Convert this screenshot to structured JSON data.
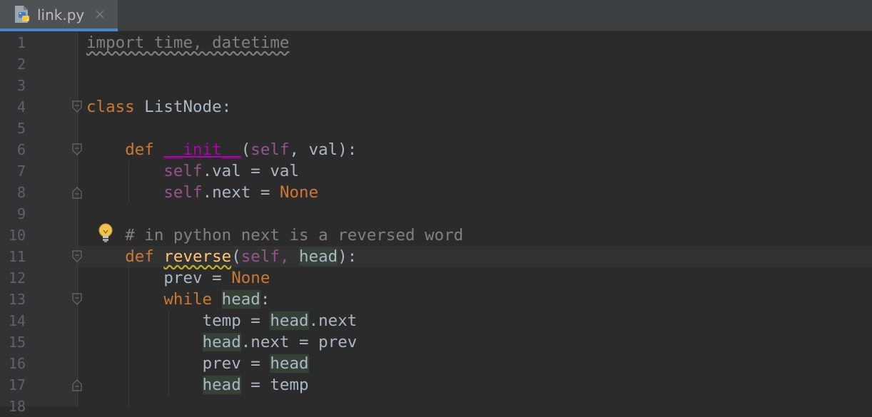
{
  "tab": {
    "filename": "link.py",
    "close_glyph": "×",
    "icon": "python-icon"
  },
  "line_numbers": [
    "1",
    "2",
    "3",
    "4",
    "5",
    "6",
    "7",
    "8",
    "9",
    "10",
    "11",
    "12",
    "13",
    "14",
    "15",
    "16",
    "17",
    "18"
  ],
  "code": {
    "l1": {
      "text": "import time, datetime"
    },
    "l4": {
      "kw": "class",
      "rest": " ListNode:"
    },
    "l6": {
      "indent": "    ",
      "kw": "def",
      "sp": " ",
      "fn": "__init__",
      "open": "(",
      "self": "self",
      "rest": ", val):"
    },
    "l7": {
      "indent": "        ",
      "self": "self",
      "rest": ".val = val"
    },
    "l8": {
      "indent": "        ",
      "self": "self",
      "mid": ".next = ",
      "kw": "None"
    },
    "l10": {
      "indent": "    ",
      "comment": "# in python next is a reversed word"
    },
    "l11": {
      "indent": "    ",
      "kw": "def",
      "sp": " ",
      "fn": "reverse",
      "open": "(",
      "self": "self",
      "comma": ", ",
      "param": "head",
      "close": "):"
    },
    "l12": {
      "indent": "        ",
      "pre": "prev = ",
      "kw": "None"
    },
    "l13": {
      "indent": "        ",
      "kw": "while",
      "sp": " ",
      "var": "head",
      "rest": ":"
    },
    "l14": {
      "indent": "            ",
      "pre": "temp = ",
      "var": "head",
      "rest": ".next"
    },
    "l15": {
      "indent": "            ",
      "var": "head",
      "rest": ".next = prev"
    },
    "l16": {
      "indent": "            ",
      "pre": "prev = ",
      "var": "head"
    },
    "l17": {
      "indent": "            ",
      "var": "head",
      "rest": " = temp"
    }
  },
  "colors": {
    "background": "#2b2b2b",
    "gutter": "#313335",
    "keyword": "#cc7832",
    "self": "#94558d",
    "function": "#ffc66d",
    "comment": "#808080",
    "text": "#a9b7c6",
    "tab_accent": "#4a88c7"
  },
  "icons": [
    "python-icon",
    "close-icon",
    "fold-icon",
    "lightbulb-icon"
  ]
}
